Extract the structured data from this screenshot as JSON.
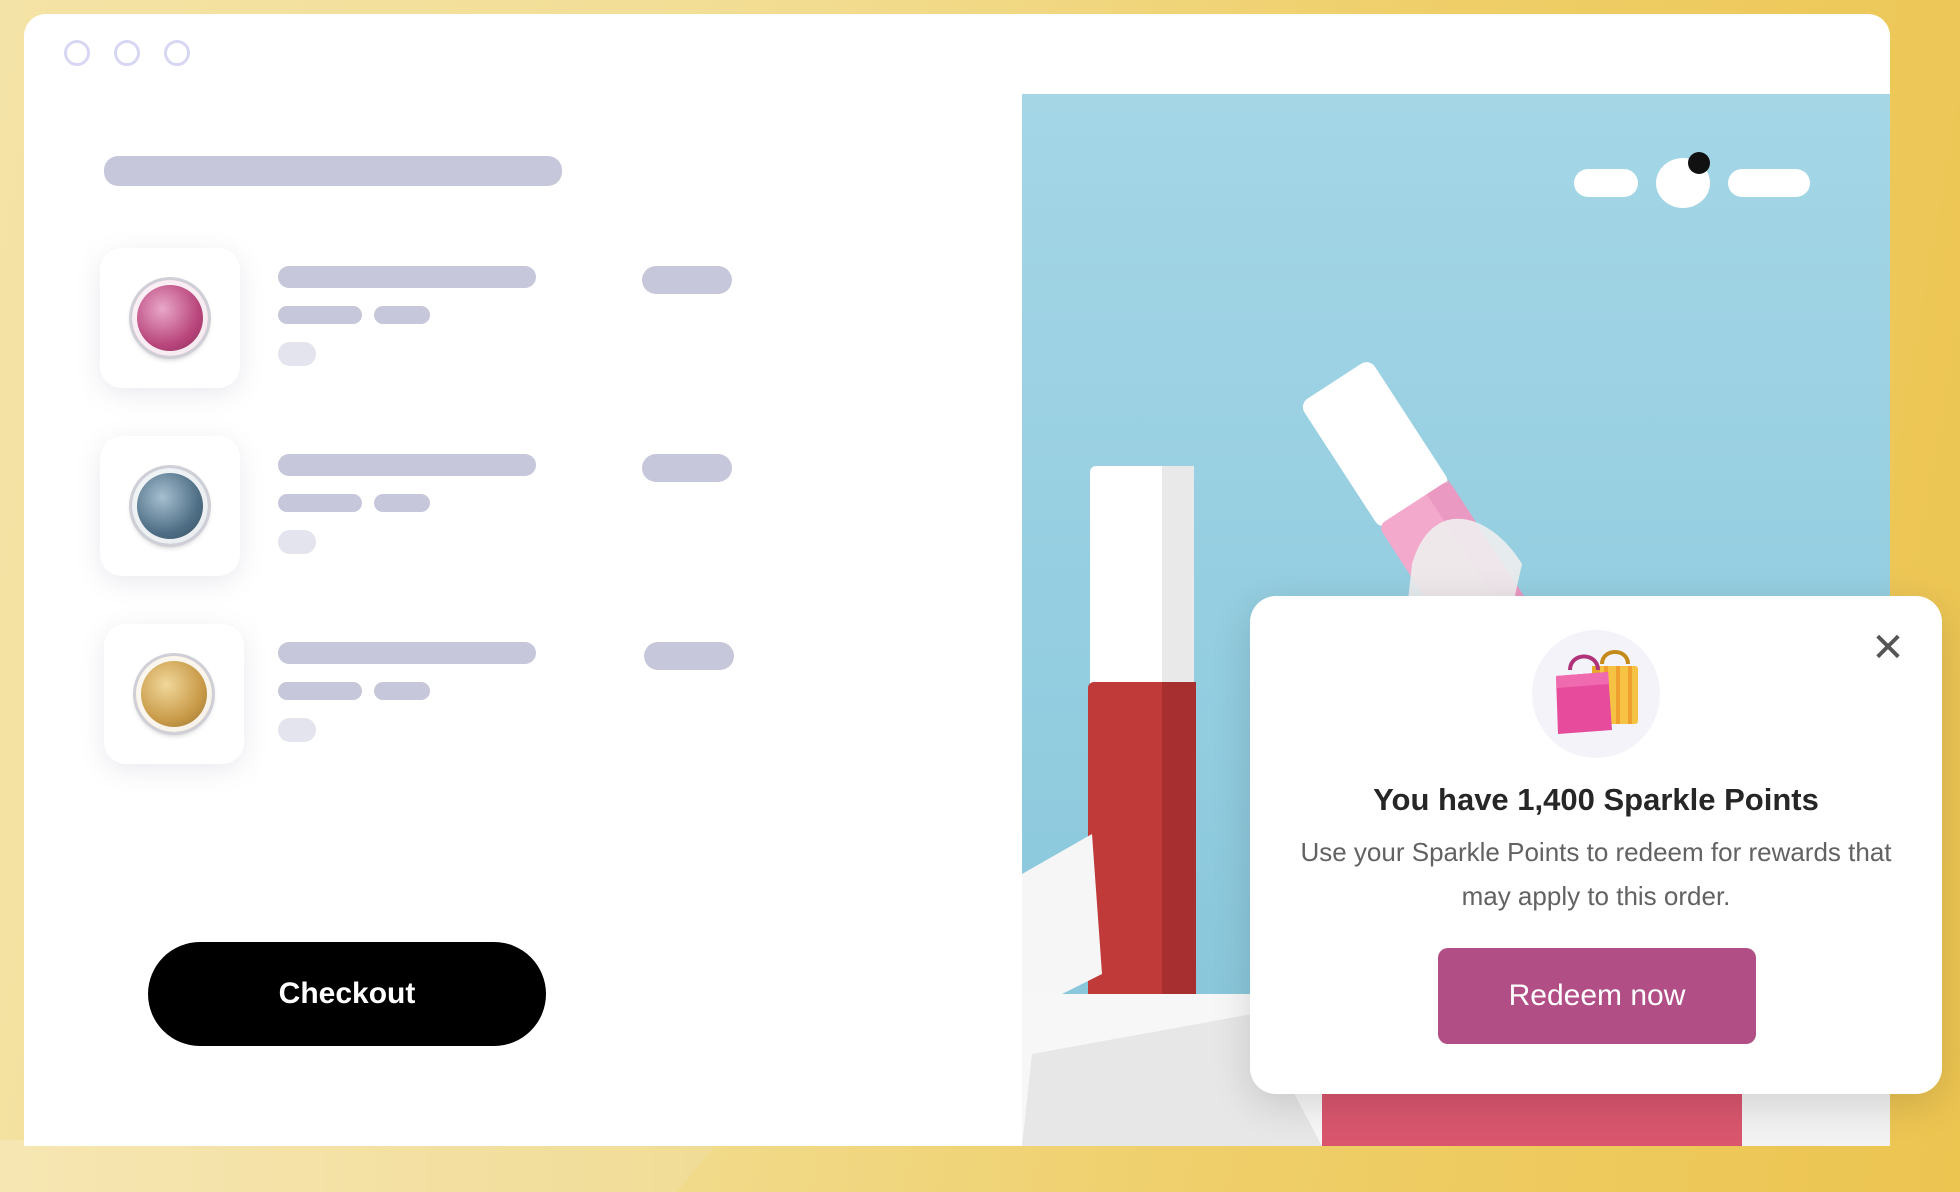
{
  "checkout": {
    "label": "Checkout"
  },
  "popup": {
    "close_symbol": "✕",
    "icon": "shopping-bags-icon",
    "title": "You have 1,400 Sparkle Points",
    "body": "Use your Sparkle Points to redeem for rewards that may apply to this order.",
    "cta": "Redeem now"
  },
  "cart": {
    "items": [
      {
        "swatch": "pink",
        "color": "#b9467c"
      },
      {
        "swatch": "blue",
        "color": "#4f6f86"
      },
      {
        "swatch": "gold",
        "color": "#c89a48"
      }
    ]
  },
  "colors": {
    "accent": "#b14e86",
    "checkout_bg": "#000000",
    "skeleton": "#c6c7da"
  }
}
